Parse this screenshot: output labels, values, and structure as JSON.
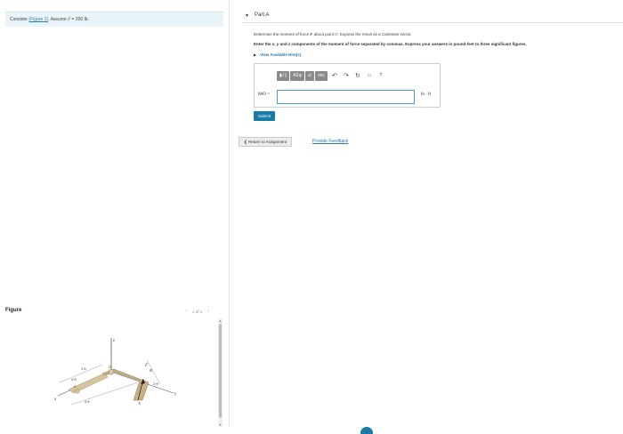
{
  "prompt": {
    "prefix": "Consider",
    "link": "(Figure 1)",
    "suffix_pre": ". Assume",
    "var": "F",
    "eq": "= 200",
    "unit": "lb",
    "end": "."
  },
  "figure": {
    "title": "Figure",
    "pager": "1 of 1",
    "labels": {
      "z": "z",
      "x": "x",
      "y": "y",
      "o": "O",
      "a": "A",
      "b": "B",
      "c": "C",
      "f": "F",
      "d1": "1 ft",
      "d2": "4 ft",
      "d3": "4 ft",
      "d4": "2 ft"
    }
  },
  "part": {
    "title": "Part A"
  },
  "question": {
    "line1_a": "Determine the moment of force",
    "line1_var": "F",
    "line1_b": "about point",
    "line1_pt": "O",
    "line1_c": ". Express the result as a Cartesian vector.",
    "line2_a": "Enter the",
    "line2_x": "x",
    "line2_b": ",",
    "line2_y": "y",
    "line2_c": "and",
    "line2_z": "z",
    "line2_d": "components of the moment of force separated by commas. Express your answers in pound-feet to three significant figures."
  },
  "hint": {
    "label": "View Available Hint(s)"
  },
  "toolbar": {
    "templates": "▮√▯",
    "symbols": "AΣφ",
    "vector": "⇄",
    "vec": "vec",
    "help": "?"
  },
  "answer": {
    "label": "MO =",
    "unit": "lb · ft",
    "value": ""
  },
  "buttons": {
    "submit": "Submit",
    "return": "❮ Return to Assignment",
    "feedback": "Provide Feedback"
  }
}
